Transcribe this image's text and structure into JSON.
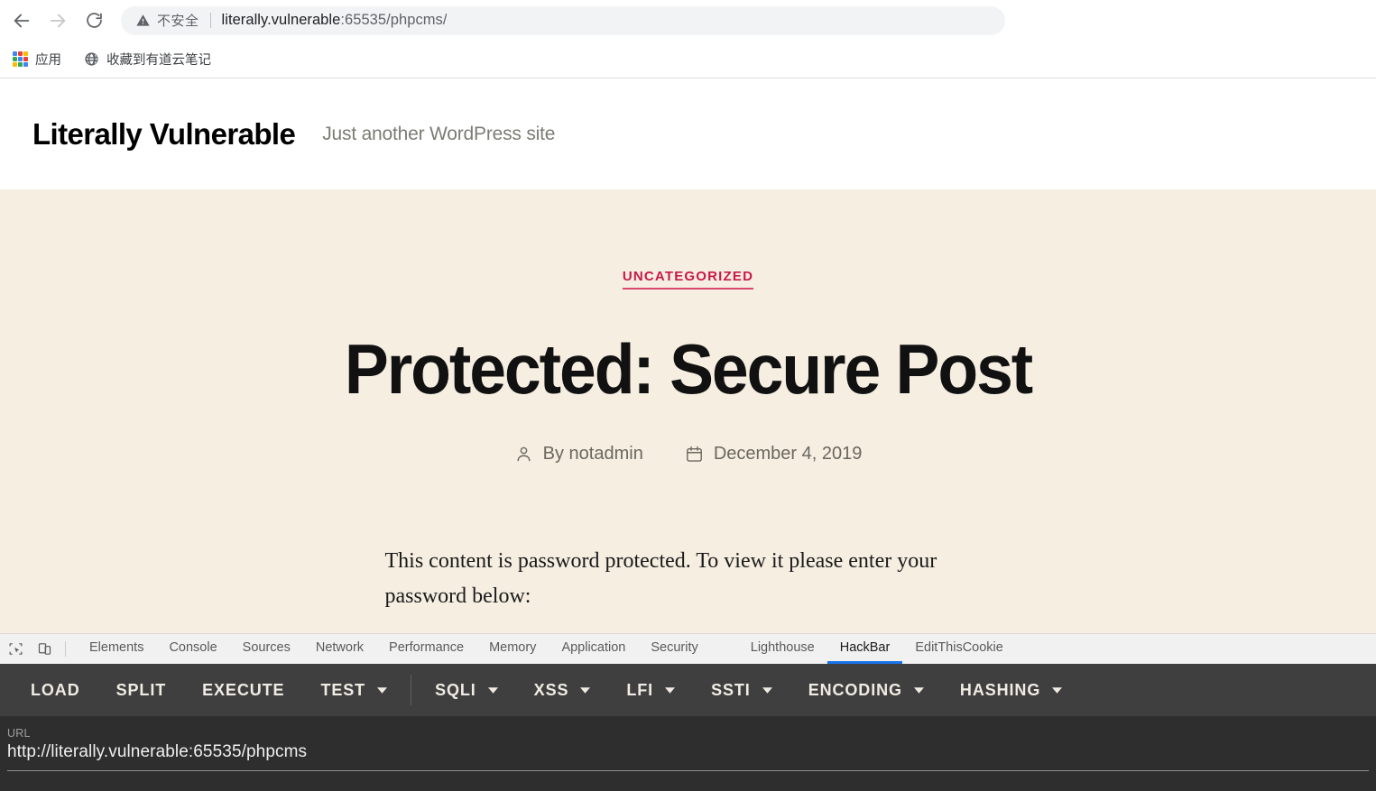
{
  "browser": {
    "back_label": "Back",
    "forward_label": "Forward",
    "reload_label": "Reload",
    "security_text": "不安全",
    "url_display_main": "literally.vulnerable",
    "url_display_rest": ":65535/phpcms/",
    "bookmarks": [
      {
        "label": "应用",
        "icon": "apps-grid-icon"
      },
      {
        "label": "收藏到有道云笔记",
        "icon": "globe-icon"
      }
    ]
  },
  "site": {
    "title": "Literally Vulnerable",
    "tagline": "Just another WordPress site"
  },
  "post": {
    "category": "UNCATEGORIZED",
    "title": "Protected: Secure Post",
    "author": "By notadmin",
    "date": "December 4, 2019",
    "body": "This content is password protected. To view it please enter your password below:"
  },
  "devtools": {
    "inspect_icon": "inspect-element-icon",
    "device_icon": "device-toolbar-icon",
    "tabs": [
      {
        "label": "Elements",
        "active": false
      },
      {
        "label": "Console",
        "active": false
      },
      {
        "label": "Sources",
        "active": false
      },
      {
        "label": "Network",
        "active": false
      },
      {
        "label": "Performance",
        "active": false
      },
      {
        "label": "Memory",
        "active": false
      },
      {
        "label": "Application",
        "active": false
      },
      {
        "label": "Security",
        "active": false
      },
      {
        "label": "Lighthouse",
        "active": false
      },
      {
        "label": "HackBar",
        "active": true
      },
      {
        "label": "EditThisCookie",
        "active": false
      }
    ]
  },
  "hackbar": {
    "buttons": [
      {
        "label": "LOAD",
        "caret": false
      },
      {
        "label": "SPLIT",
        "caret": false
      },
      {
        "label": "EXECUTE",
        "caret": false
      },
      {
        "label": "TEST",
        "caret": true
      },
      {
        "label": "SQLI",
        "caret": true
      },
      {
        "label": "XSS",
        "caret": true
      },
      {
        "label": "LFI",
        "caret": true
      },
      {
        "label": "SSTI",
        "caret": true
      },
      {
        "label": "ENCODING",
        "caret": true
      },
      {
        "label": "HASHING",
        "caret": true
      }
    ],
    "separator_after_index": 3,
    "url_label": "URL",
    "url_value": "http://literally.vulnerable:65535/phpcms"
  },
  "colors": {
    "page_bg": "#f5eee1",
    "accent_category": "#c9184a",
    "hackbar_toolbar_bg": "#3f3f3f",
    "hackbar_body_bg": "#2e2e2e",
    "active_tab_underline": "#1a73e8"
  }
}
